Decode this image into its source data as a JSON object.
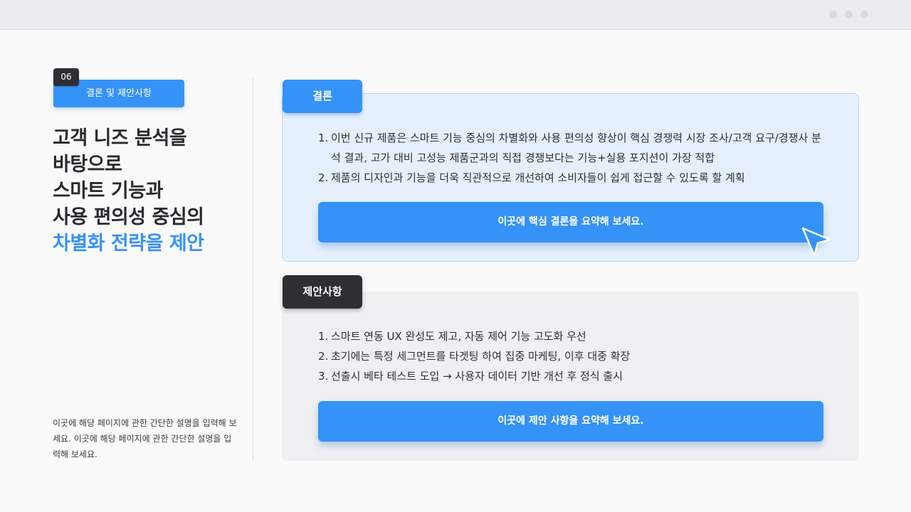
{
  "left": {
    "slide_number": "06",
    "section_tag": "결론 및 제안사항",
    "title_lines": [
      "고객 니즈 분석을",
      "바탕으로",
      "스마트 기능과",
      "사용 편의성 중심의"
    ],
    "title_accent": "차별화 전략을 제안",
    "description": "이곳에 해당 페이지에 관한 간단한 설명을 입력해 보세요. 이곳에 해당 페이지에 관한 간단한 설명을 입력해 보세요."
  },
  "conclusion": {
    "label": "결론",
    "items": [
      {
        "num": "1.",
        "text": "이번 신규 제품은 스마트 기능 중심의 차별화와 사용 편의성 향상이 핵심 경쟁력 시장 조사/고객 요구/경쟁사 분석 결과, 고가 대비 고성능 제품군과의 직접 경쟁보다는 기능+실용 포지션이 가장 적합"
      },
      {
        "num": "2.",
        "text": "제품의 디자인과 기능을 더욱 직관적으로 개선하여 소비자들이 쉽게 접근할 수 있도록 할 계획"
      }
    ],
    "summary": "이곳에 핵심 결론을 요약해 보세요."
  },
  "proposal": {
    "label": "제안사항",
    "items": [
      {
        "num": "1.",
        "text": "스마트 연동 UX 완성도 제고, 자동 제어 기능 고도화 우선"
      },
      {
        "num": "2.",
        "text": "초기에는 특정 세그먼트를 타겟팅 하여 집중 마케팅, 이후 대중 확장"
      },
      {
        "num": "3.",
        "text": "선출시 베타 테스트 도입 → 사용자 데이터 기반 개선 후 정식 출시"
      }
    ],
    "summary": "이곳에 제안 사항을 요약해 보세요."
  },
  "icons": [
    "window-dot-icon",
    "cursor-arrow-icon"
  ],
  "colors": {
    "accent": "#3592f7",
    "dark": "#2f2f33",
    "panel_light": "#e6f0fd"
  }
}
